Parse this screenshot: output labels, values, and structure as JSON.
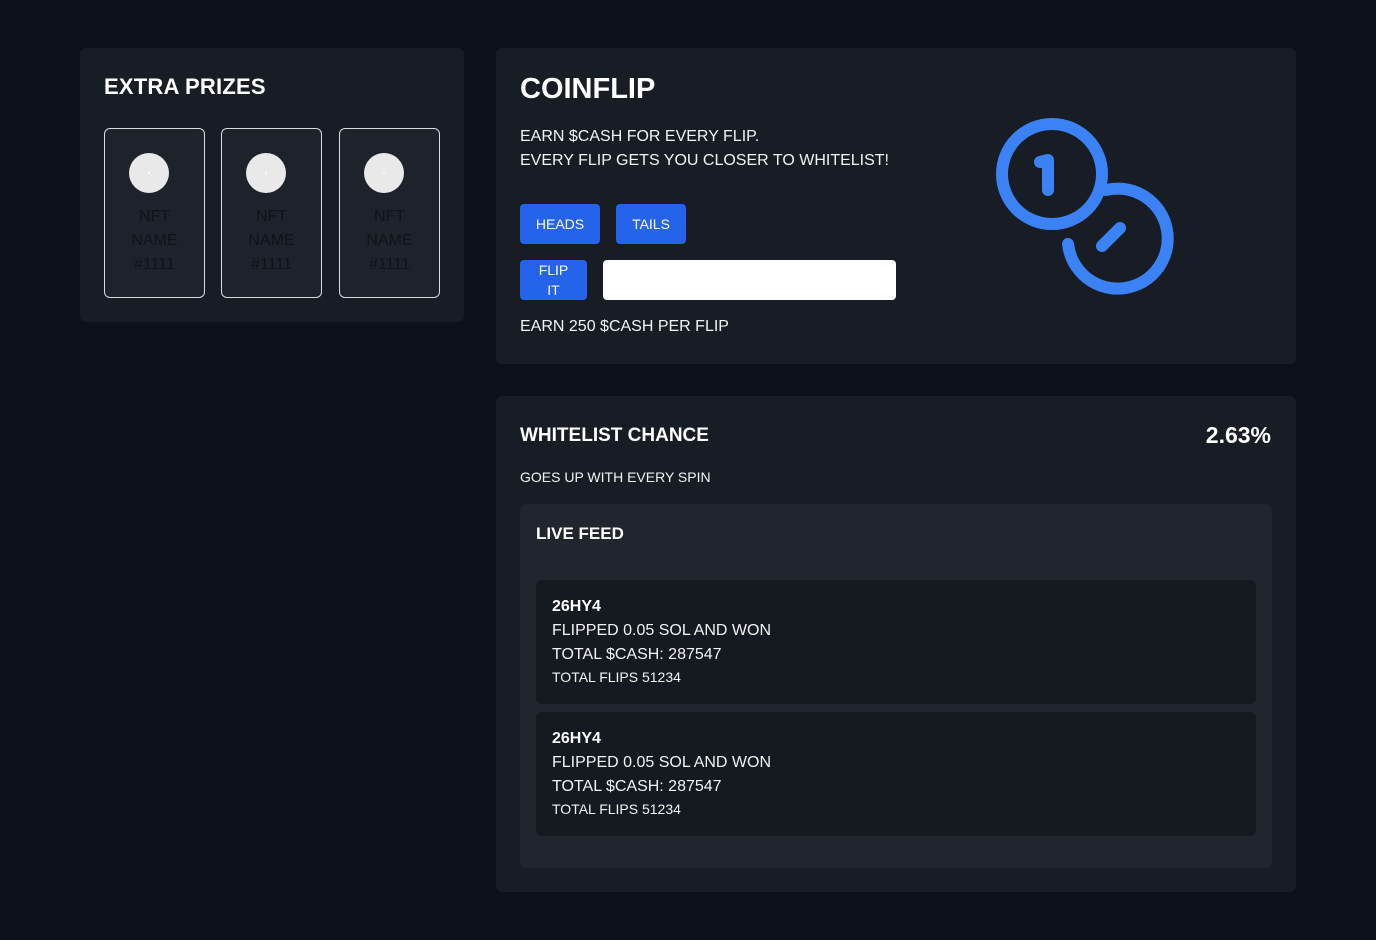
{
  "extra_prizes": {
    "title": "EXTRA PRIZES",
    "items": [
      {
        "name_line1": "NFT",
        "name_line2": "NAME",
        "name_line3": "#1111"
      },
      {
        "name_line1": "NFT",
        "name_line2": "NAME",
        "name_line3": "#1111"
      },
      {
        "name_line1": "NFT",
        "name_line2": "NAME",
        "name_line3": "#1111"
      }
    ]
  },
  "coinflip": {
    "title": "COINFLIP",
    "desc_line1": "EARN $CASH FOR EVERY FLIP.",
    "desc_line2": "EVERY FLIP GETS YOU CLOSER TO WHITELIST!",
    "heads_label": "HEADS",
    "tails_label": "TAILS",
    "flip_label": "FLIP IT",
    "amount_value": "",
    "earn_text": "EARN 250 $CASH PER FLIP",
    "icon": "coins-icon",
    "accent_color": "#2563eb",
    "icon_color": "#3b82f6"
  },
  "whitelist": {
    "title": "WHITELIST CHANCE",
    "percent": "2.63%",
    "subtitle": "GOES UP WITH EVERY SPIN",
    "feed": {
      "title": "LIVE FEED",
      "items": [
        {
          "user": "26HY4",
          "action": "FLIPPED 0.05 SOL AND WON",
          "total_cash": "TOTAL $CASH: 287547",
          "total_flips": "TOTAL FLIPS 51234"
        },
        {
          "user": "26HY4",
          "action": "FLIPPED 0.05 SOL AND WON",
          "total_cash": "TOTAL $CASH: 287547",
          "total_flips": "TOTAL FLIPS 51234"
        }
      ]
    }
  }
}
